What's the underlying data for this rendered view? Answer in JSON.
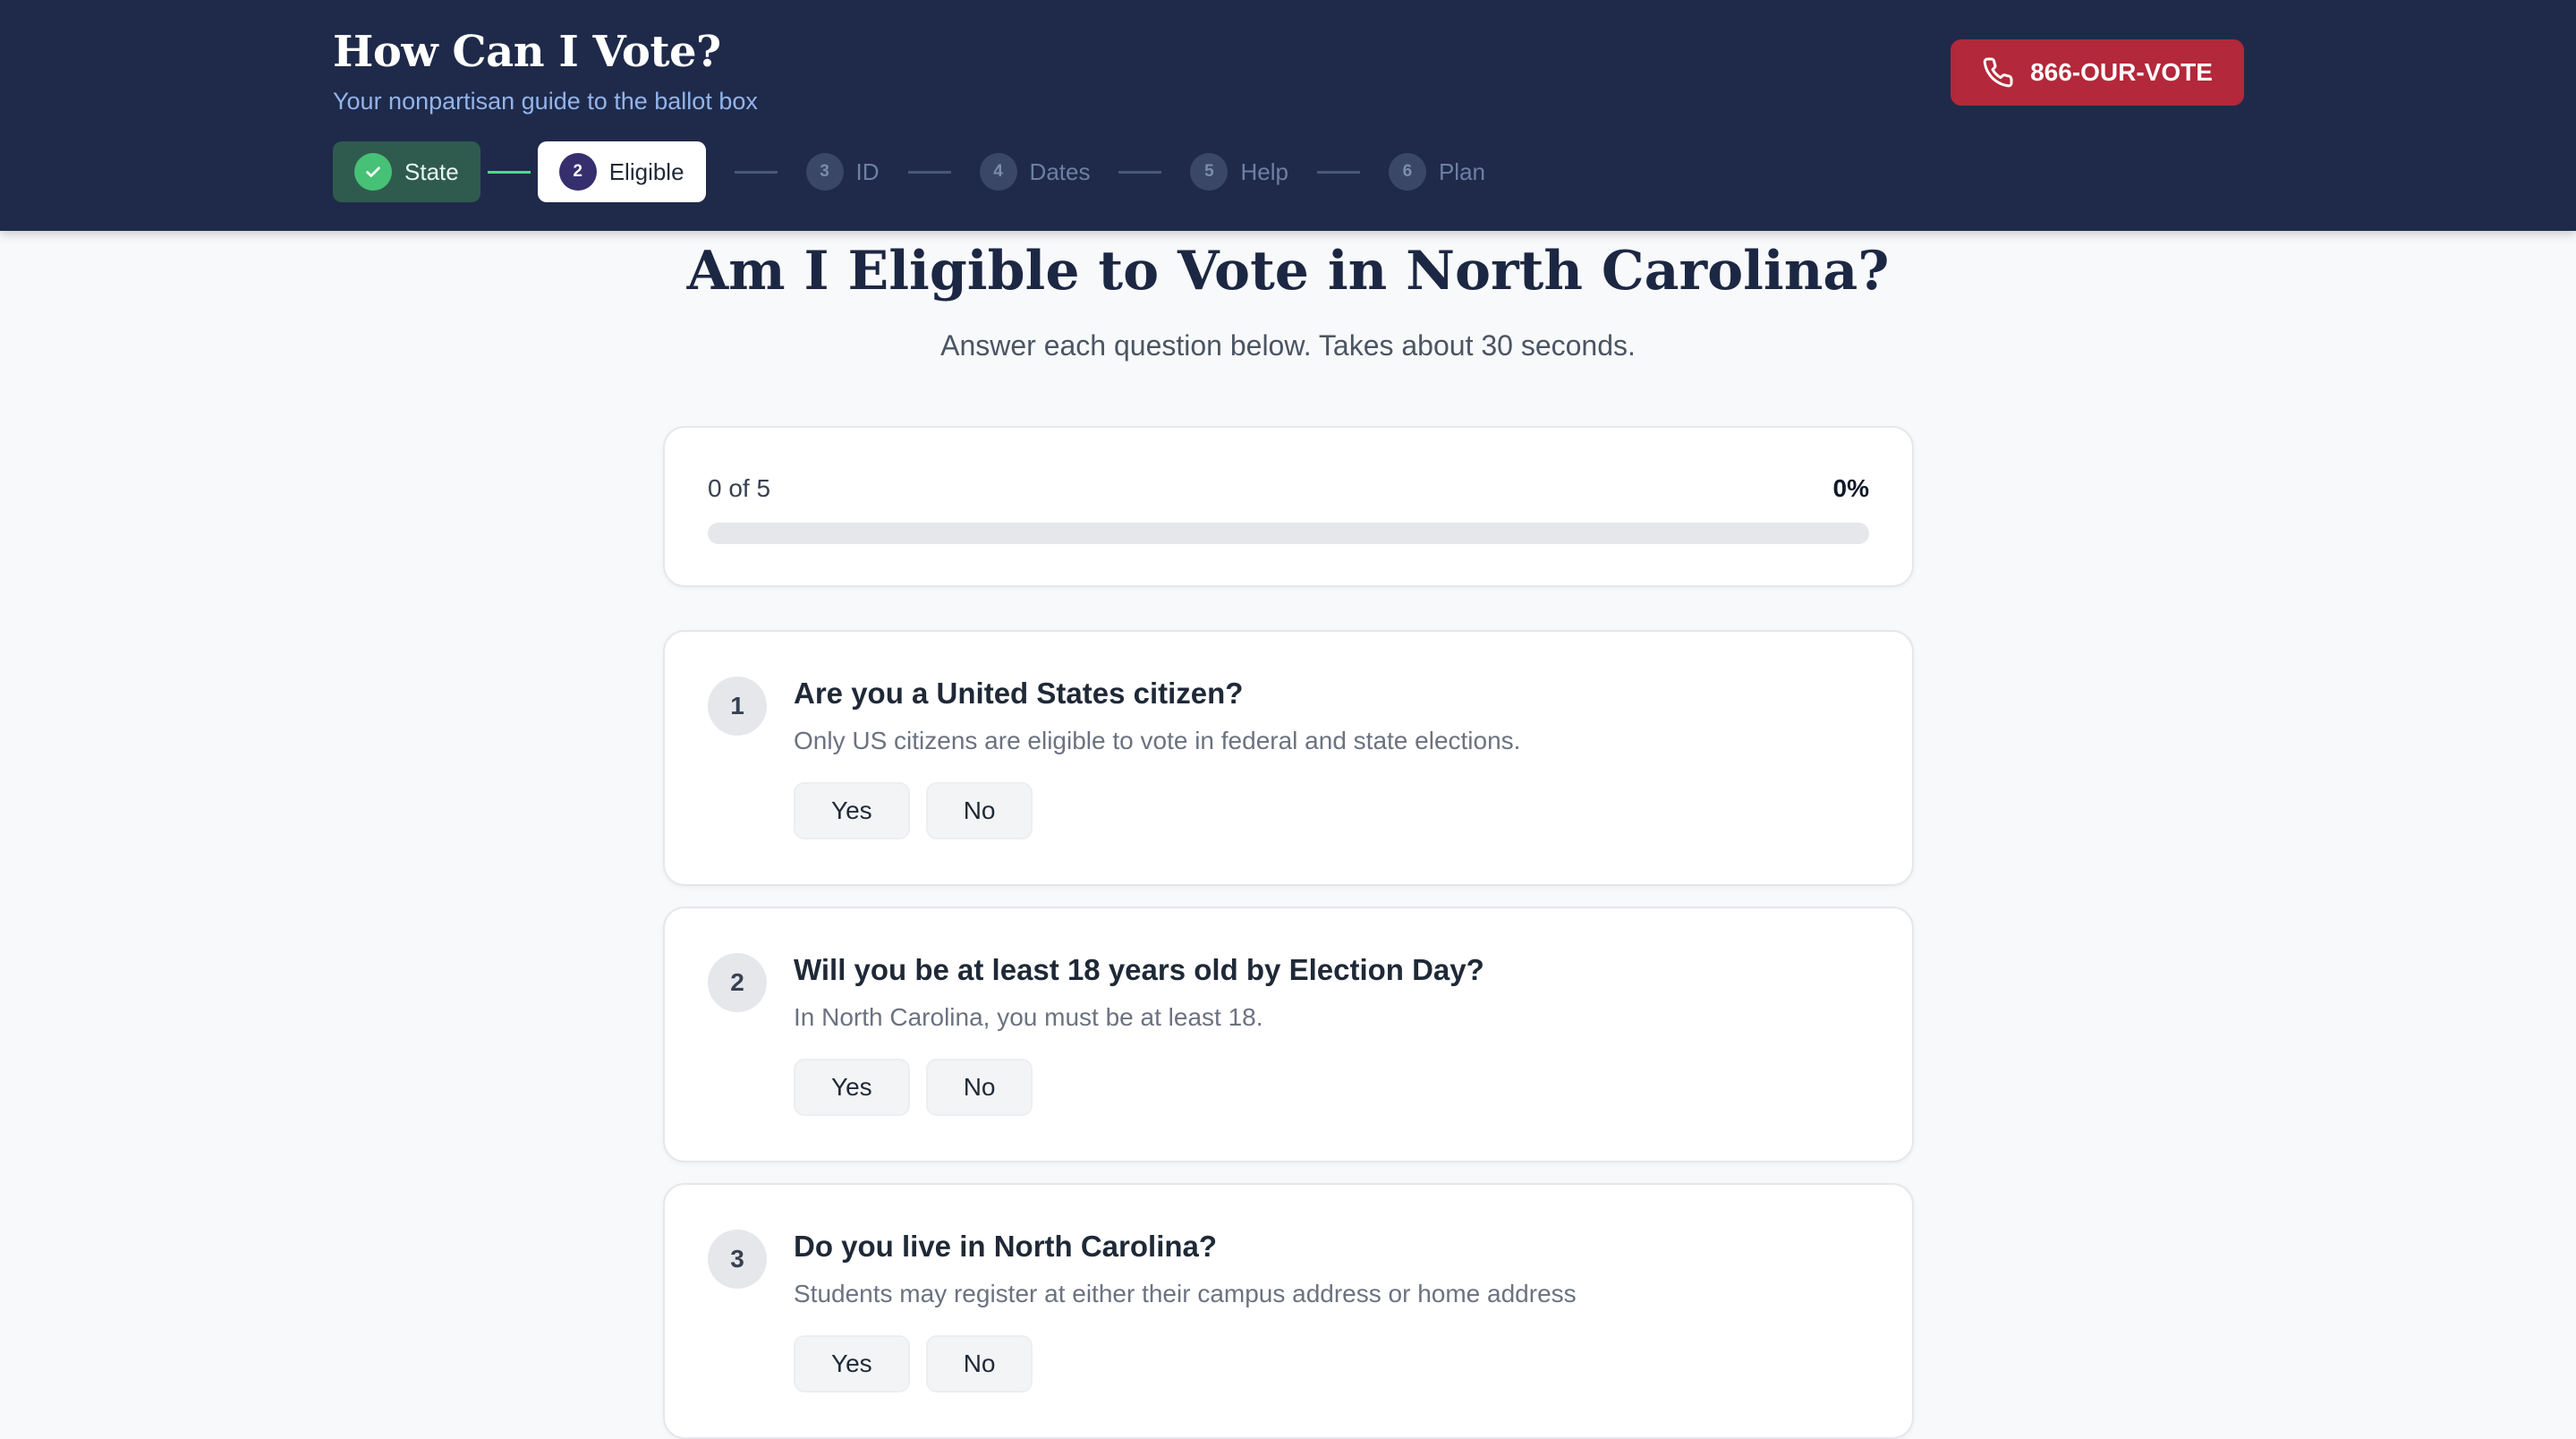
{
  "header": {
    "title": "How Can I Vote?",
    "subtitle": "Your nonpartisan guide to the ballot box",
    "hotline_label": "866-OUR-VOTE",
    "hotline_icon": "phone-icon"
  },
  "steps": [
    {
      "number": "✓",
      "label": "State",
      "status": "completed"
    },
    {
      "number": "2",
      "label": "Eligible",
      "status": "active"
    },
    {
      "number": "3",
      "label": "ID",
      "status": "upcoming"
    },
    {
      "number": "4",
      "label": "Dates",
      "status": "upcoming"
    },
    {
      "number": "5",
      "label": "Help",
      "status": "upcoming"
    },
    {
      "number": "6",
      "label": "Plan",
      "status": "upcoming"
    }
  ],
  "main": {
    "title": "Am I Eligible to Vote in North Carolina?",
    "subtitle": "Answer each question below. Takes about 30 seconds."
  },
  "progress": {
    "count_text": "0 of 5",
    "percent_text": "0%",
    "fraction": 0
  },
  "questions": [
    {
      "number": "1",
      "title": "Are you a United States citizen?",
      "description": "Only US citizens are eligible to vote in federal and state elections.",
      "yes_label": "Yes",
      "no_label": "No"
    },
    {
      "number": "2",
      "title": "Will you be at least 18 years old by Election Day?",
      "description": "In North Carolina, you must be at least 18.",
      "yes_label": "Yes",
      "no_label": "No"
    },
    {
      "number": "3",
      "title": "Do you live in North Carolina?",
      "description": "Students may register at either their campus address or home address",
      "yes_label": "Yes",
      "no_label": "No"
    }
  ],
  "colors": {
    "header_bg": "#1f2a4a",
    "accent_red": "#b3283a",
    "step_done_green": "#47c176",
    "step_active_dark": "#362f6e"
  }
}
